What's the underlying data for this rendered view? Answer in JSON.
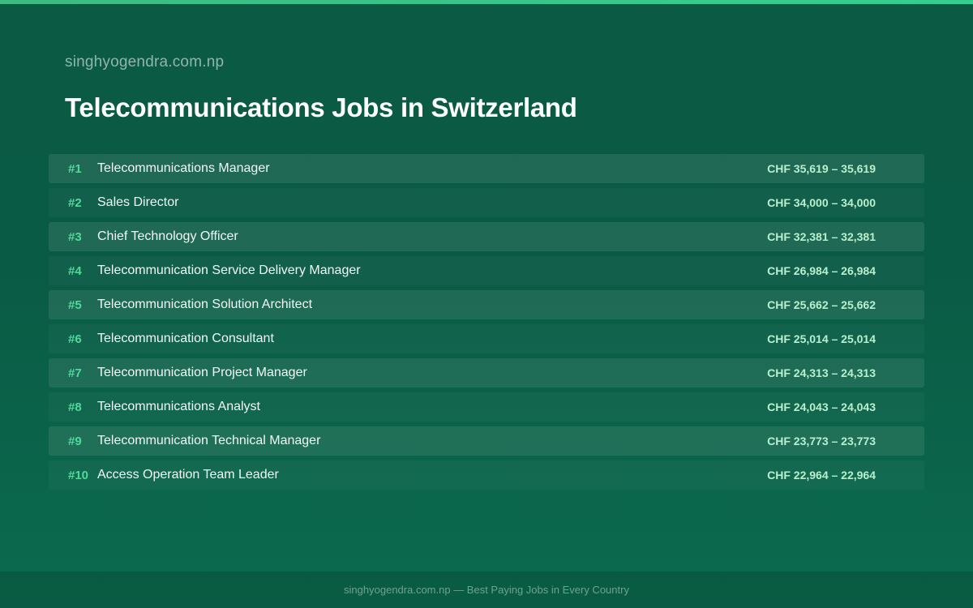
{
  "site_name": "singhyogendra.com.np",
  "title": "Telecommunications Jobs in Switzerland",
  "colors": {
    "accent": "#3dbb80",
    "rank": "#4fd99a",
    "salary": "#b8f0cf",
    "background": "#0b5a44"
  },
  "jobs": [
    {
      "rank": "#1",
      "title": "Telecommunications Manager",
      "salary": "CHF 35,619 – 35,619"
    },
    {
      "rank": "#2",
      "title": "Sales Director",
      "salary": "CHF 34,000 – 34,000"
    },
    {
      "rank": "#3",
      "title": "Chief Technology Officer",
      "salary": "CHF 32,381 – 32,381"
    },
    {
      "rank": "#4",
      "title": "Telecommunication Service Delivery Manager",
      "salary": "CHF 26,984 – 26,984"
    },
    {
      "rank": "#5",
      "title": "Telecommunication Solution Architect",
      "salary": "CHF 25,662 – 25,662"
    },
    {
      "rank": "#6",
      "title": "Telecommunication Consultant",
      "salary": "CHF 25,014 – 25,014"
    },
    {
      "rank": "#7",
      "title": "Telecommunication Project Manager",
      "salary": "CHF 24,313 – 24,313"
    },
    {
      "rank": "#8",
      "title": "Telecommunications Analyst",
      "salary": "CHF 24,043 – 24,043"
    },
    {
      "rank": "#9",
      "title": "Telecommunication Technical Manager",
      "salary": "CHF 23,773 – 23,773"
    },
    {
      "rank": "#10",
      "title": "Access Operation Team Leader",
      "salary": "CHF 22,964 – 22,964"
    }
  ],
  "footer": {
    "text": "singhyogendra.com.np — Best Paying Jobs in Every Country"
  }
}
